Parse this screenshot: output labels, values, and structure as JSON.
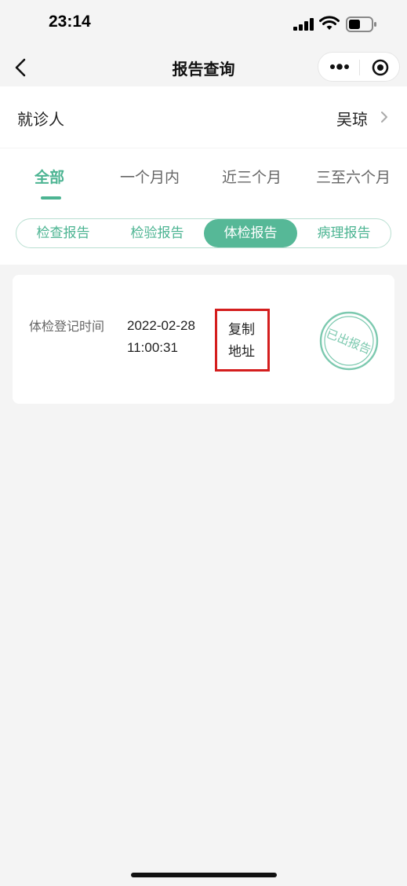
{
  "status_bar": {
    "time": "23:14"
  },
  "nav": {
    "title": "报告查询"
  },
  "patient": {
    "label": "就诊人",
    "name": "吴琼"
  },
  "time_tabs": [
    "全部",
    "一个月内",
    "近三个月",
    "三至六个月"
  ],
  "report_types": [
    "检查报告",
    "检验报告",
    "体检报告",
    "病理报告"
  ],
  "selected_time_tab": "全部",
  "selected_report_type": "体检报告",
  "report": {
    "label": "体检登记时间",
    "date": "2022-02-28",
    "time": "11:00:31",
    "copy_line1": "复制",
    "copy_line2": "地址",
    "stamp_text": "已出报告"
  },
  "colors": {
    "accent": "#4cb492",
    "highlight_box": "#d41e1e"
  }
}
